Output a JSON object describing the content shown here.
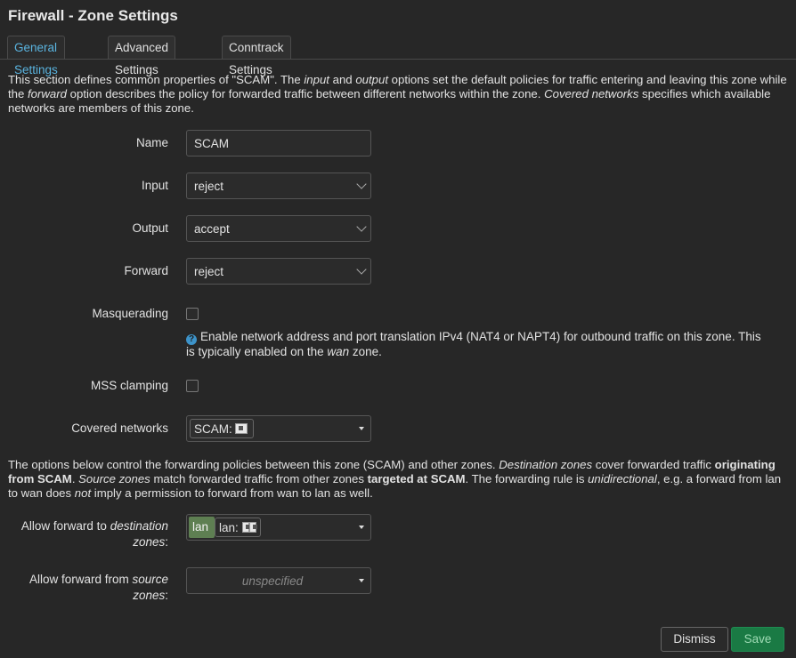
{
  "page": {
    "title": "Firewall - Zone Settings"
  },
  "tabs": [
    {
      "label": "General Settings",
      "active": true
    },
    {
      "label": "Advanced Settings",
      "active": false
    },
    {
      "label": "Conntrack Settings",
      "active": false
    }
  ],
  "intro": {
    "p1": "This section defines common properties of \"SCAM\". The ",
    "i1": "input",
    "p2": " and ",
    "i2": "output",
    "p3": " options set the default policies for traffic entering and leaving this zone while the ",
    "i3": "forward",
    "p4": " option describes the policy for forwarded traffic between different networks within the zone. ",
    "i4": "Covered networks",
    "p5": " specifies which available networks are members of this zone."
  },
  "form": {
    "name": {
      "label": "Name",
      "value": "SCAM"
    },
    "input": {
      "label": "Input",
      "value": "reject"
    },
    "output": {
      "label": "Output",
      "value": "accept"
    },
    "forward": {
      "label": "Forward",
      "value": "reject"
    },
    "masq": {
      "label": "Masquerading",
      "checked": false,
      "hint_a": "Enable network address and port translation IPv4 (NAT4 or NAPT4) for outbound traffic on this zone. This is typically enabled on the ",
      "hint_i": "wan",
      "hint_b": " zone."
    },
    "mss": {
      "label": "MSS clamping",
      "checked": false
    },
    "covered": {
      "label": "Covered networks",
      "chip": "SCAM:"
    }
  },
  "forwarding_desc": {
    "p1": "The options below control the forwarding policies between this zone (SCAM) and other zones. ",
    "i1": "Destination zones",
    "p2": " cover forwarded traffic ",
    "b1": "originating from SCAM",
    "p3": ". ",
    "i2": "Source zones",
    "p4": " match forwarded traffic from other zones ",
    "b2": "targeted at SCAM",
    "p5": ". The forwarding rule is ",
    "i3": "unidirectional",
    "p6": ", e.g. a forward from lan to wan does ",
    "i4": "not",
    "p7": " imply a permission to forward from wan to lan as well."
  },
  "fwd_dest": {
    "label_a": "Allow forward to ",
    "label_i": "destination",
    "label_b": "zones",
    "label_c": ":",
    "zone": "lan",
    "chip": "lan:"
  },
  "fwd_src": {
    "label_a": "Allow forward from ",
    "label_i": "source",
    "label_b": "zones",
    "label_c": ":",
    "placeholder": "unspecified"
  },
  "buttons": {
    "dismiss": "Dismiss",
    "save": "Save"
  },
  "colors": {
    "accent": "#5ab4e0",
    "save": "#1a7a44",
    "zone_lan": "#5e7f52"
  }
}
